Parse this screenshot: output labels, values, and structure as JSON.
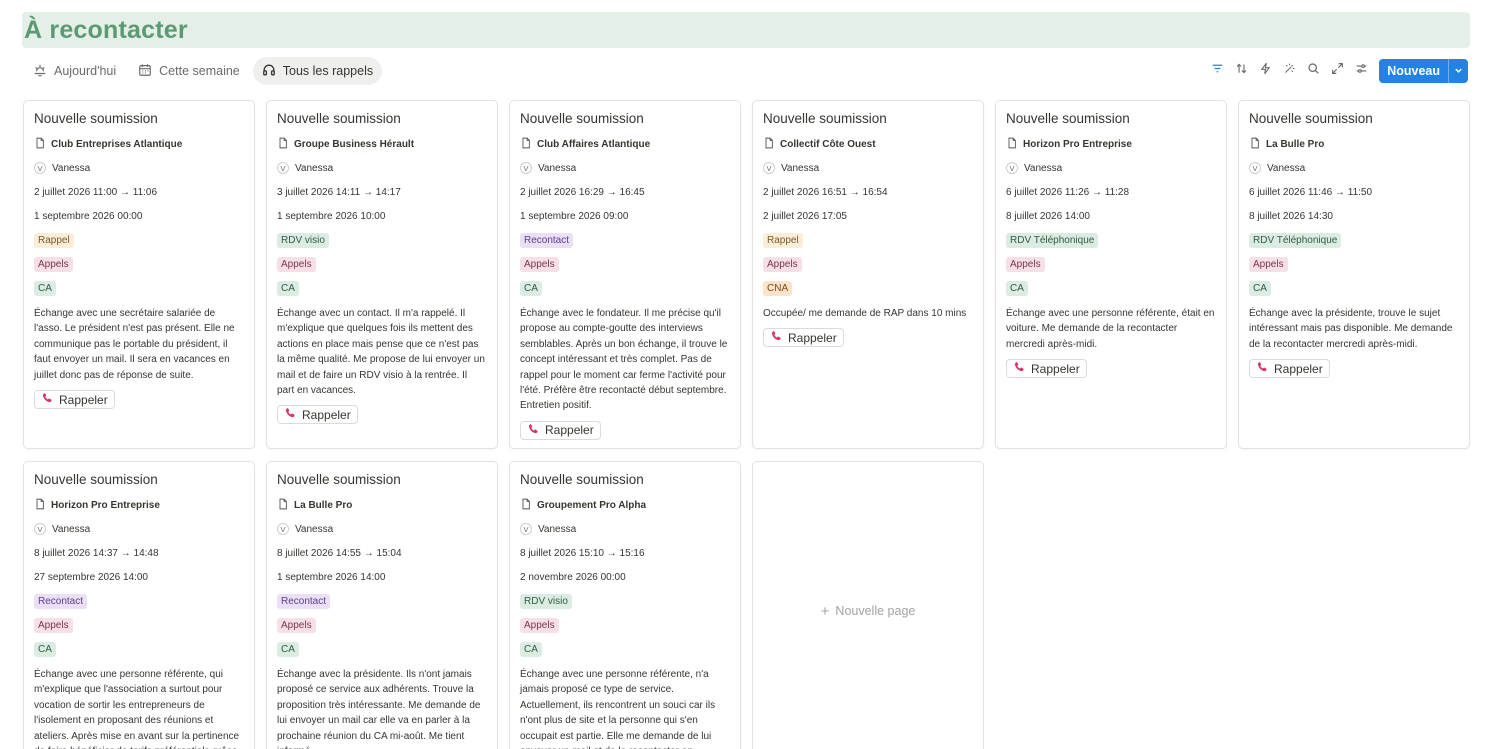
{
  "page": {
    "title": "À recontacter"
  },
  "tabs": [
    {
      "label": "Aujourd'hui",
      "icon": "sun-horizon-icon",
      "active": false
    },
    {
      "label": "Cette semaine",
      "icon": "calendar-icon",
      "active": false
    },
    {
      "label": "Tous les rappels",
      "icon": "headset-icon",
      "active": true
    }
  ],
  "toolbar": {
    "icons": [
      "filter-icon",
      "sort-icon",
      "lightning-icon",
      "magic-wand-icon",
      "search-icon",
      "expand-icon",
      "settings-sliders-icon"
    ],
    "new_label": "Nouveau"
  },
  "colors": {
    "accent": "#2383e2",
    "title": "#5b9a72",
    "title_bg": "#e4efe8",
    "call_icon": "#d8336b"
  },
  "cards": [
    {
      "title": "Nouvelle soumission",
      "org": "Club Entreprises Atlantique",
      "person": "Vanessa",
      "avatar": "V",
      "date": "2 juillet 2026 11:00 → 11:06",
      "recall": "1 septembre 2026 00:00",
      "status": "Rappel",
      "status_color": "yellow",
      "type": "Appels",
      "group": "CA",
      "group_color": "green",
      "note": "Échange avec une secrétaire salariée de l'asso. Le président n'est pas présent. Elle ne communique pas le portable du président, il faut envoyer un mail. Il sera en vacances en juillet donc pas de réponse de suite.",
      "button": "Rappeler"
    },
    {
      "title": "Nouvelle soumission",
      "org": "Groupe Business Hérault",
      "person": "Vanessa",
      "avatar": "V",
      "date": "3 juillet 2026 14:11 → 14:17",
      "recall": "1 septembre 2026 10:00",
      "status": "RDV visio",
      "status_color": "green",
      "type": "Appels",
      "group": "CA",
      "group_color": "green",
      "note": "Échange avec un contact. Il m'a rappelé. Il m'explique que quelques fois ils mettent des actions en place mais pense que ce n'est pas la même qualité. Me propose de lui envoyer un mail et de faire un RDV visio à la rentrée. Il part en vacances.",
      "button": "Rappeler"
    },
    {
      "title": "Nouvelle soumission",
      "org": "Club Affaires Atlantique",
      "person": "Vanessa",
      "avatar": "V",
      "date": "2 juillet 2026 16:29 → 16:45",
      "recall": "1 septembre 2026 09:00",
      "status": "Recontact",
      "status_color": "purple",
      "type": "Appels",
      "group": "CA",
      "group_color": "green",
      "note": "Échange avec le fondateur. Il me précise qu'il propose au compte-goutte des interviews semblables. Après un bon échange, il trouve le concept intéressant et très complet. Pas de rappel pour le moment car ferme l'activité pour l'été. Préfère être recontacté début septembre. Entretien positif.",
      "button": "Rappeler"
    },
    {
      "title": "Nouvelle soumission",
      "org": "Collectif Côte Ouest",
      "person": "Vanessa",
      "avatar": "V",
      "date": "2 juillet 2026 16:51 → 16:54",
      "recall": "2 juillet 2026 17:05",
      "status": "Rappel",
      "status_color": "yellow",
      "type": "Appels",
      "group": "CNA",
      "group_color": "orange",
      "note": "Occupée/ me demande de RAP dans 10 mins",
      "button": "Rappeler"
    },
    {
      "title": "Nouvelle soumission",
      "org": "Horizon Pro Entreprise",
      "person": "Vanessa",
      "avatar": "V",
      "date": "6 juillet 2026 11:26 → 11:28",
      "recall": "8 juillet 2026 14:00",
      "status": "RDV Téléphonique",
      "status_color": "green",
      "type": "Appels",
      "group": "CA",
      "group_color": "green",
      "note": "Échange avec une personne référente, était en voiture. Me demande de la recontacter mercredi après-midi.",
      "button": "Rappeler"
    },
    {
      "title": "Nouvelle soumission",
      "org": "La Bulle Pro",
      "person": "Vanessa",
      "avatar": "V",
      "date": "6 juillet 2026 11:46 → 11:50",
      "recall": "8 juillet 2026 14:30",
      "status": "RDV Téléphonique",
      "status_color": "green",
      "type": "Appels",
      "group": "CA",
      "group_color": "green",
      "note": "Échange avec la présidente, trouve le sujet intéressant mais pas disponible. Me demande de la recontacter mercredi après-midi.",
      "button": "Rappeler"
    },
    {
      "title": "Nouvelle soumission",
      "org": "Horizon Pro Entreprise",
      "person": "Vanessa",
      "avatar": "V",
      "date": "8 juillet 2026 14:37 → 14:48",
      "recall": "27 septembre 2026 14:00",
      "status": "Recontact",
      "status_color": "purple",
      "type": "Appels",
      "group": "CA",
      "group_color": "green",
      "note": "Échange avec une personne référente, qui m'explique que l'association a surtout pour vocation de sortir les entrepreneurs de l'isolement en proposant des réunions et ateliers. Après mise en avant sur la pertinence de faire bénéficier de tarifs préférentiels grâce",
      "button": ""
    },
    {
      "title": "Nouvelle soumission",
      "org": "La Bulle Pro",
      "person": "Vanessa",
      "avatar": "V",
      "date": "8 juillet 2026 14:55 → 15:04",
      "recall": "1 septembre 2026 14:00",
      "status": "Recontact",
      "status_color": "purple",
      "type": "Appels",
      "group": "CA",
      "group_color": "green",
      "note": "Échange avec la présidente. Ils n'ont jamais proposé ce service aux adhérents. Trouve la proposition très intéressante. Me demande de lui envoyer un mail car elle va en parler à la prochaine réunion du CA mi-août. Me tient informé.",
      "button": ""
    },
    {
      "title": "Nouvelle soumission",
      "org": "Groupement Pro Alpha",
      "person": "Vanessa",
      "avatar": "V",
      "date": "8 juillet 2026 15:10 → 15:16",
      "recall": "2 novembre 2026 00:00",
      "status": "RDV visio",
      "status_color": "green",
      "type": "Appels",
      "group": "CA",
      "group_color": "green",
      "note": "Échange avec une personne référente, n'a jamais proposé ce type de service. Actuellement, ils rencontrent un souci car ils n'ont plus de site et la personne qui s'en occupait est partie. Elle me demande de lui envoyer un mail et de la recontacter en",
      "button": ""
    }
  ],
  "new_page": {
    "label": "Nouvelle page"
  }
}
